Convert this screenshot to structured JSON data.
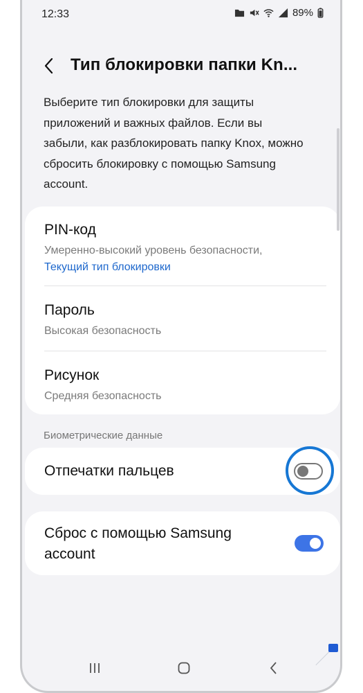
{
  "status_bar": {
    "time": "12:33",
    "battery": "89%",
    "icons": [
      "knox-folder-icon",
      "mute-icon",
      "wifi-icon",
      "signal-icon",
      "battery-icon"
    ]
  },
  "app_bar": {
    "title": "Тип блокировки папки Kn...",
    "back_icon": "back-arrow-icon"
  },
  "description": "Выберите тип блокировки для защиты приложений и важных файлов. Если вы забыли, как разблокировать папку Knox, можно сбросить блокировку с помощью Samsung account.",
  "lock_options": [
    {
      "title": "PIN-код",
      "subtitle": "Умеренно-высокий уровень безопасности,",
      "current": "Текущий тип блокировки"
    },
    {
      "title": "Пароль",
      "subtitle": "Высокая безопасность"
    },
    {
      "title": "Рисунок",
      "subtitle": "Средняя безопасность"
    }
  ],
  "biometrics": {
    "header": "Биометрические данные",
    "fingerprints_label": "Отпечатки пальцев",
    "fingerprints_enabled": false
  },
  "reset": {
    "label": "Сброс с помощью Samsung account",
    "enabled": true
  },
  "colors": {
    "accent": "#3d74e6",
    "link": "#1d67cc",
    "highlight": "#1677d4",
    "background": "#f3f3f6",
    "card": "#ffffff"
  },
  "nav_bar": {
    "icons": [
      "recents-icon",
      "home-icon",
      "back-icon"
    ]
  }
}
